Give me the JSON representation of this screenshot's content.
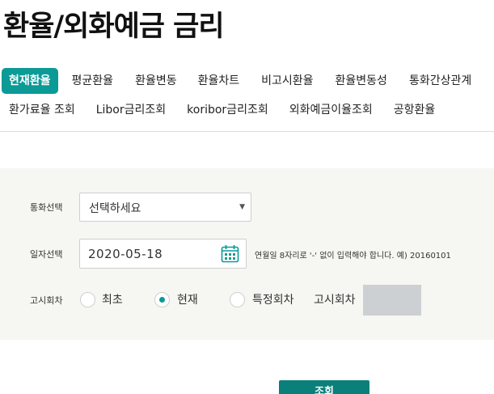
{
  "page": {
    "title": "환율/외화예금 금리"
  },
  "tabs": {
    "row1": [
      {
        "label": "현재환율",
        "active": true
      },
      {
        "label": "평균환율"
      },
      {
        "label": "환율변동"
      },
      {
        "label": "환율차트"
      },
      {
        "label": "비고시환율"
      },
      {
        "label": "환율변동성"
      },
      {
        "label": "통화간상관계"
      }
    ],
    "row2": [
      {
        "label": "환가료율 조회"
      },
      {
        "label": "Libor금리조회"
      },
      {
        "label": "koribor금리조회"
      },
      {
        "label": "외화예금이율조회"
      },
      {
        "label": "공항환율"
      }
    ]
  },
  "form": {
    "currency_label": "통화선택",
    "currency_value": "선택하세요",
    "date_label": "일자선택",
    "date_value": "2020-05-18",
    "date_help": "연월일 8자리로 '-' 없이 입력해야 합니다. 예) 20160101",
    "round_label": "고시회차",
    "radio_options": [
      {
        "label": "최초",
        "checked": false
      },
      {
        "label": "현재",
        "checked": true
      },
      {
        "label": "특정회차",
        "checked": false
      }
    ],
    "round_input_label": "고시회차",
    "submit_label": "조회"
  },
  "colors": {
    "accent": "#0b9a96",
    "button": "#0b7f7a",
    "panel": "#f6f6f3"
  },
  "icons": {
    "calendar": "calendar-icon",
    "dropdown": "chevron-down-icon"
  }
}
